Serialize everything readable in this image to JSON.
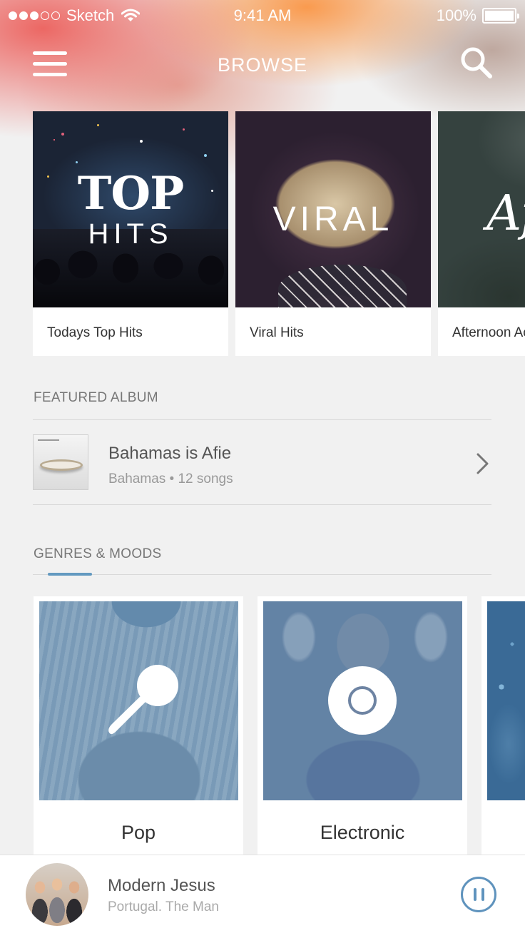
{
  "status_bar": {
    "carrier": "Sketch",
    "time": "9:41 AM",
    "battery": "100%"
  },
  "nav": {
    "title": "BROWSE"
  },
  "playlists": [
    {
      "art_line1": "TOP",
      "art_line2": "HITS",
      "caption": "Todays Top Hits"
    },
    {
      "art_text": "VIRAL",
      "caption": "Viral Hits"
    },
    {
      "art_text": "Af",
      "caption": "Afternoon Ac"
    }
  ],
  "featured": {
    "label": "FEATURED ALBUM",
    "album_title": "Bahamas is Afie",
    "album_sub": "Bahamas • 12 songs"
  },
  "genres": {
    "label": "GENRES & MOODS",
    "items": [
      {
        "label": "Pop",
        "icon": "microphone-icon"
      },
      {
        "label": "Electronic",
        "icon": "disc-icon"
      },
      {
        "label": "",
        "icon": ""
      }
    ]
  },
  "player": {
    "track": "Modern Jesus",
    "artist": "Portugal. The Man"
  },
  "colors": {
    "accent": "#6399c0",
    "pause": "#5f93bd"
  }
}
